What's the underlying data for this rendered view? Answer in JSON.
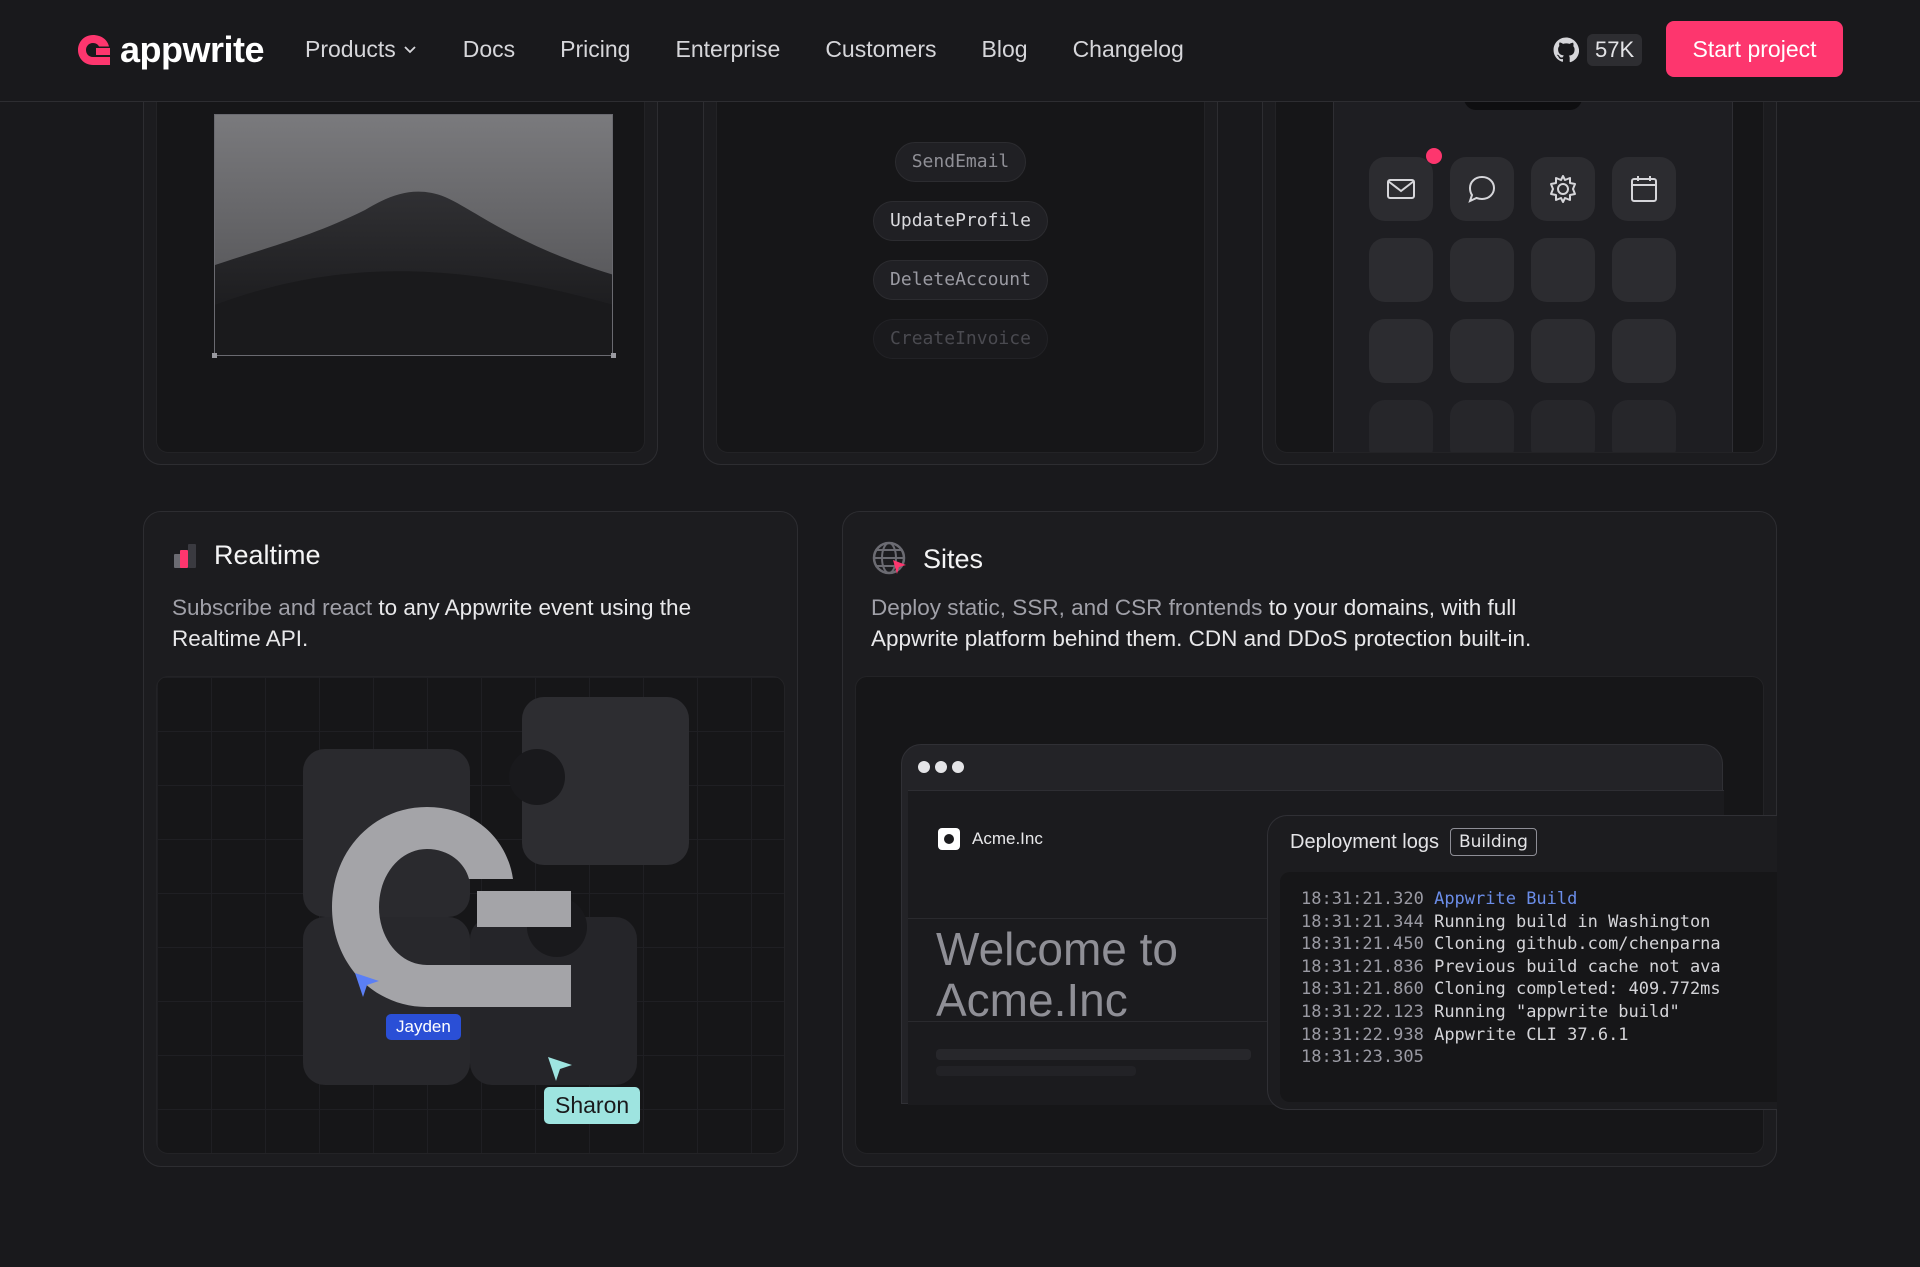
{
  "nav": {
    "brand": "appwrite",
    "links": [
      "Products",
      "Docs",
      "Pricing",
      "Enterprise",
      "Customers",
      "Blog",
      "Changelog"
    ],
    "github_stars": "57K",
    "cta": "Start project"
  },
  "functions_card": {
    "functions": [
      "SendEmail",
      "UpdateProfile",
      "DeleteAccount",
      "CreateInvoice"
    ]
  },
  "realtime": {
    "title": "Realtime",
    "desc_muted": "Subscribe and react",
    "desc_rest": " to any Appwrite event using the Realtime API.",
    "cursors": [
      {
        "name": "Jayden",
        "color": "#2a4fd6"
      },
      {
        "name": "Sharon",
        "color": "#9ee4e0"
      }
    ]
  },
  "sites": {
    "title": "Sites",
    "desc_muted": "Deploy static, SSR, and CSR frontends",
    "desc_rest": " to your domains, with full Appwrite platform behind them. CDN and DDoS protection built-in.",
    "site_name": "Acme.Inc",
    "headline_line1": "Welcome to",
    "headline_line2": "Acme.Inc",
    "logs_title": "Deployment logs",
    "logs_status": "Building",
    "logs": [
      {
        "time": "18:31:21.320",
        "msg": "Appwrite Build",
        "highlight": true
      },
      {
        "time": "18:31:21.344",
        "msg": "Running build in Washington",
        "highlight": false
      },
      {
        "time": "18:31:21.450",
        "msg": "Cloning github.com/chenparnа",
        "highlight": false
      },
      {
        "time": "18:31:21.836",
        "msg": "Previous build cache not avа",
        "highlight": false
      },
      {
        "time": "18:31:21.860",
        "msg": "Cloning completed: 409.772ms",
        "highlight": false
      },
      {
        "time": "18:31:22.123",
        "msg": "Running \"appwrite build\"",
        "highlight": false
      },
      {
        "time": "18:31:22.938",
        "msg": "Appwrite CLI 37.6.1",
        "highlight": false
      },
      {
        "time": "18:31:23.305",
        "msg": "",
        "highlight": false
      }
    ]
  },
  "colors": {
    "brand": "#fd366e",
    "background": "#19191c"
  }
}
